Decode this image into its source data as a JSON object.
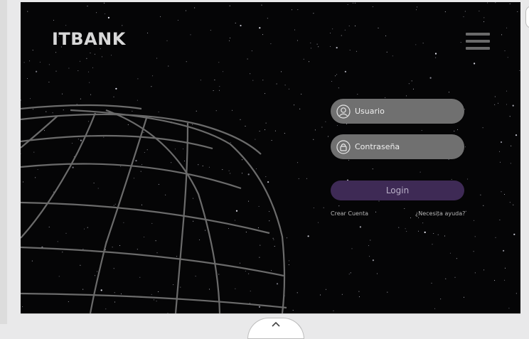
{
  "header": {
    "logo": "ITBANK",
    "menu_icon": "hamburger-menu-icon"
  },
  "login_form": {
    "username_placeholder": "Usuario",
    "password_placeholder": "Contraseña",
    "login_label": "Login",
    "create_account_label": "Crear Cuenta",
    "help_label": "¿Necesita ayuda?"
  },
  "icons": {
    "user": "user-icon",
    "lock": "lock-icon",
    "scroll_up": "chevron-up-icon"
  },
  "colors": {
    "background": "#050506",
    "field": "#707070",
    "login_button": "#3e2a55",
    "logo": "#d8d8d8"
  }
}
